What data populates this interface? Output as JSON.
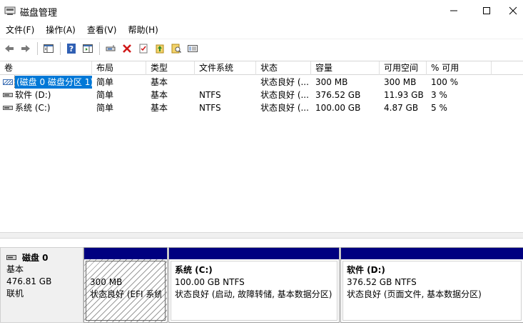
{
  "window": {
    "title": "磁盘管理"
  },
  "menu": [
    {
      "label": "文件(F)"
    },
    {
      "label": "操作(A)"
    },
    {
      "label": "查看(V)"
    },
    {
      "label": "帮助(H)"
    }
  ],
  "toolbar": {
    "icons": [
      "back-icon",
      "forward-icon",
      "properties-list-icon",
      "help-icon",
      "properties-panel-icon",
      "connect-disk-icon",
      "delete-icon",
      "check-icon",
      "up-icon",
      "search-icon",
      "console-icon"
    ]
  },
  "table": {
    "columns": [
      "卷",
      "布局",
      "类型",
      "文件系统",
      "状态",
      "容量",
      "可用空间",
      "% 可用"
    ],
    "rows": [
      {
        "volume": "(磁盘 0 磁盘分区 1)",
        "layout": "简单",
        "type": "基本",
        "fs": "",
        "status": "状态良好 (...",
        "capacity": "300 MB",
        "free": "300 MB",
        "pct": "100 %"
      },
      {
        "volume": "软件 (D:)",
        "layout": "简单",
        "type": "基本",
        "fs": "NTFS",
        "status": "状态良好 (...",
        "capacity": "376.52 GB",
        "free": "11.93 GB",
        "pct": "3 %"
      },
      {
        "volume": "系统 (C:)",
        "layout": "简单",
        "type": "基本",
        "fs": "NTFS",
        "status": "状态良好 (...",
        "capacity": "100.00 GB",
        "free": "4.87 GB",
        "pct": "5 %"
      }
    ]
  },
  "disk": {
    "name": "磁盘 0",
    "type": "基本",
    "size": "476.81 GB",
    "state": "联机",
    "partitions": [
      {
        "title": "",
        "size": "300 MB",
        "status": "状态良好 (EFI 系统分区)"
      },
      {
        "title": "系统 (C:)",
        "size": "100.00 GB NTFS",
        "status": "状态良好 (启动, 故障转储, 基本数据分区)"
      },
      {
        "title": "软件 (D:)",
        "size": "376.52 GB NTFS",
        "status": "状态良好 (页面文件, 基本数据分区)"
      }
    ]
  },
  "colors": {
    "partition_header": "#000080",
    "selection": "#0078d7"
  }
}
